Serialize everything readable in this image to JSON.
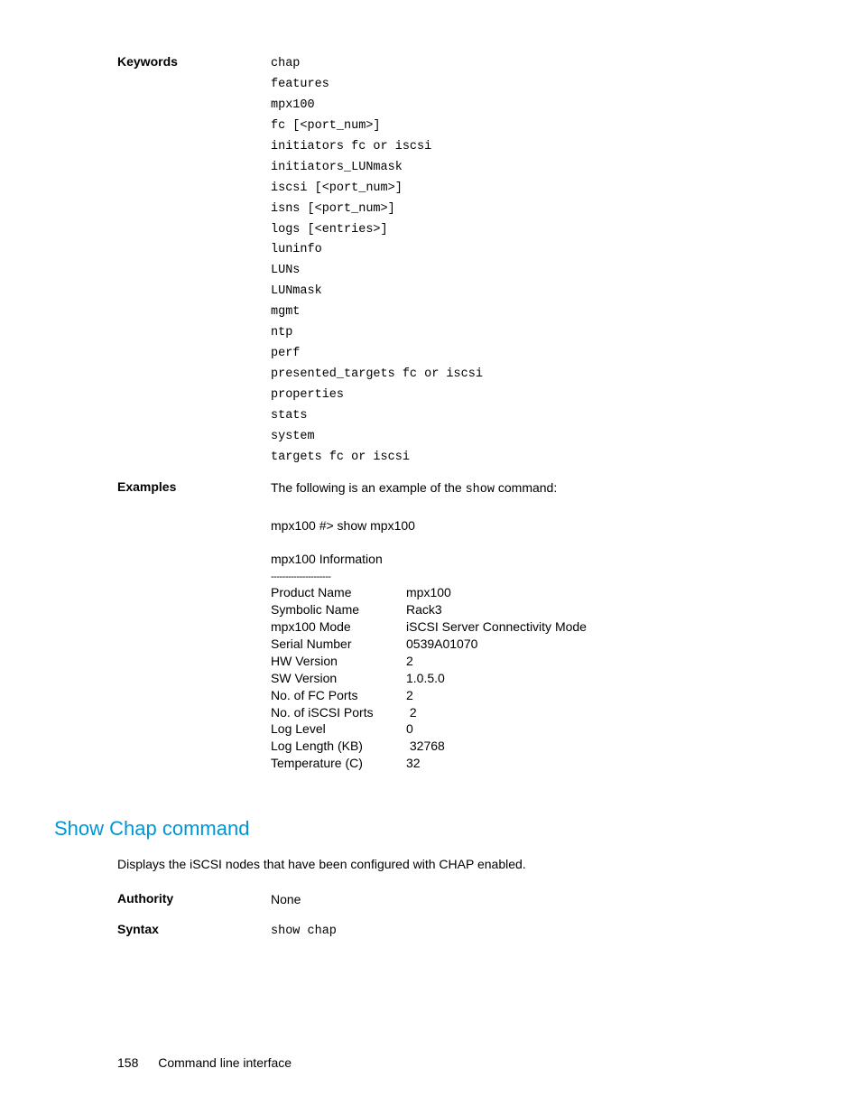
{
  "keywords": {
    "label": "Keywords",
    "items": [
      "chap",
      "features",
      "mpx100",
      "fc [<port_num>]",
      "initiators fc or iscsi",
      "initiators_LUNmask",
      "iscsi [<port_num>]",
      "isns [<port_num>]",
      "logs [<entries>]",
      "luninfo",
      "LUNs",
      "LUNmask",
      "mgmt",
      "ntp",
      "perf",
      "presented_targets fc or iscsi",
      "properties",
      "stats",
      "system",
      "targets fc or iscsi"
    ]
  },
  "examples": {
    "label": "Examples",
    "intro_pre": "The following is an example of the ",
    "intro_cmd": "show",
    "intro_post": " command:",
    "cmd_line": "mpx100 #> show mpx100",
    "info_title": "mpx100 Information",
    "dashes": "---------------------",
    "rows": [
      {
        "label": "Product Name",
        "value": "mpx100"
      },
      {
        "label": "Symbolic Name",
        "value": "Rack3"
      },
      {
        "label": "mpx100 Mode",
        "value": "iSCSI Server Connectivity Mode"
      },
      {
        "label": "Serial Number",
        "value": "0539A01070"
      },
      {
        "label": "HW Version",
        "value": "2"
      },
      {
        "label": "SW Version",
        "value": "1.0.5.0"
      },
      {
        "label": "No. of FC Ports",
        "value": "2"
      },
      {
        "label": "No. of iSCSI Ports",
        "value": " 2"
      },
      {
        "label": "Log Level",
        "value": "0"
      },
      {
        "label": "Log Length (KB)",
        "value": " 32768"
      },
      {
        "label": "Temperature (C)",
        "value": "32"
      }
    ]
  },
  "section2": {
    "heading": "Show Chap command",
    "desc": "Displays the iSCSI nodes that have been configured with CHAP enabled.",
    "authority": {
      "label": "Authority",
      "value": "None"
    },
    "syntax": {
      "label": "Syntax",
      "value": "show chap"
    }
  },
  "footer": {
    "page": "158",
    "title": "Command line interface"
  }
}
